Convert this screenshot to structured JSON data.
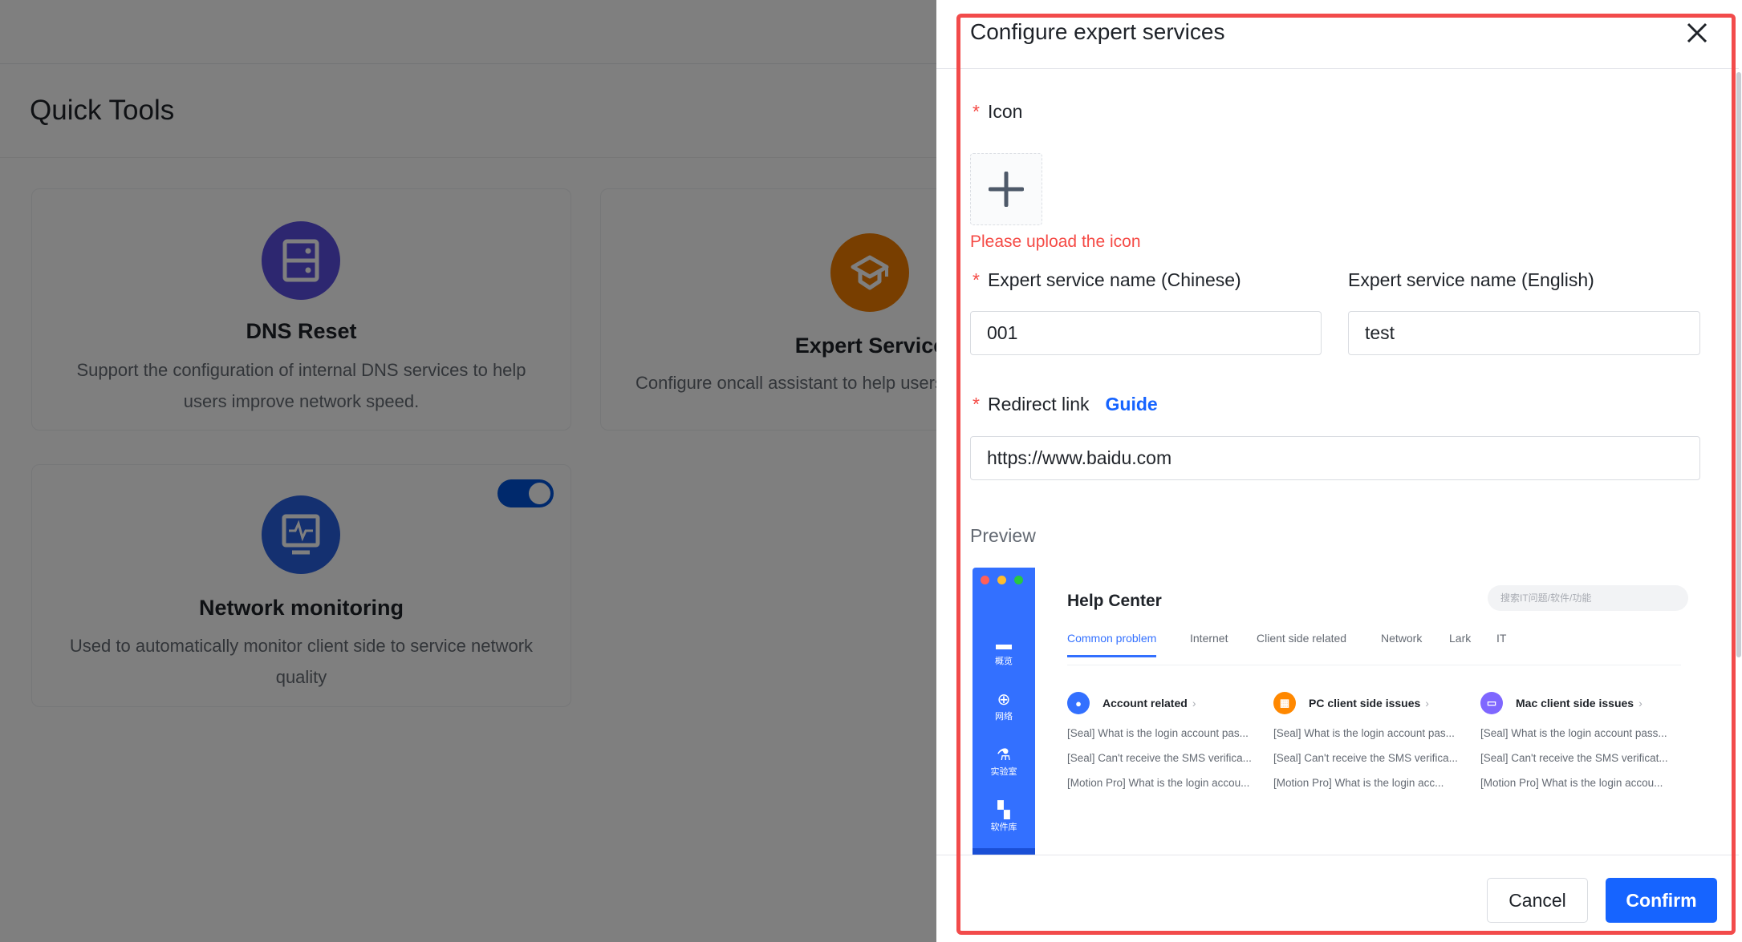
{
  "page": {
    "title": "Quick Tools"
  },
  "cards": [
    {
      "title": "DNS Reset",
      "desc": "Support the configuration of internal DNS services to help users improve network speed.",
      "icon": "server-icon",
      "color": "#5b4fe0"
    },
    {
      "title": "Expert Service",
      "desc": "Configure oncall assistant to help users",
      "icon": "graduation-cap-icon",
      "color": "#f07d00"
    },
    {
      "title": "Network monitoring",
      "desc": "Used to automatically monitor client side to service network quality",
      "icon": "monitor-pulse-icon",
      "color": "#2860e1",
      "toggle_on": true
    }
  ],
  "drawer": {
    "title": "Configure expert services",
    "icon_label": "Icon",
    "icon_error": "Please upload the icon",
    "name_cn_label": "Expert service name (Chinese)",
    "name_cn_value": "001",
    "name_en_label": "Expert service name (English)",
    "name_en_value": "test",
    "redirect_label": "Redirect link",
    "guide_label": "Guide",
    "redirect_value": "https://www.baidu.com",
    "preview_label": "Preview",
    "cancel_label": "Cancel",
    "confirm_label": "Confirm",
    "accent": "#1664ff",
    "error_color": "#f54a45"
  },
  "preview": {
    "title": "Help Center",
    "search_placeholder": "搜索IT问题/软件/功能",
    "sidebar": [
      "概览",
      "网络",
      "实验室",
      "软件库"
    ],
    "tabs": [
      "Common problem",
      "Internet",
      "Client side related",
      "Network",
      "Lark",
      "IT"
    ],
    "columns": [
      {
        "title": "Account related",
        "color": "#3370ff",
        "items": [
          "[Seal] What is the login account pas...",
          "[Seal] Can't receive the SMS verifica...",
          "[Motion Pro] What is the login accou..."
        ]
      },
      {
        "title": "PC client side issues",
        "color": "#ff8800",
        "items": [
          "[Seal] What is the login account pas...",
          "[Seal] Can't receive the SMS verifica...",
          "[Motion Pro] What is the login acc..."
        ]
      },
      {
        "title": "Mac client side issues",
        "color": "#7f67ff",
        "items": [
          "[Seal] What is the login account pass...",
          "[Seal] Can't receive the SMS verificat...",
          "[Motion Pro] What is the login accou..."
        ]
      }
    ]
  }
}
